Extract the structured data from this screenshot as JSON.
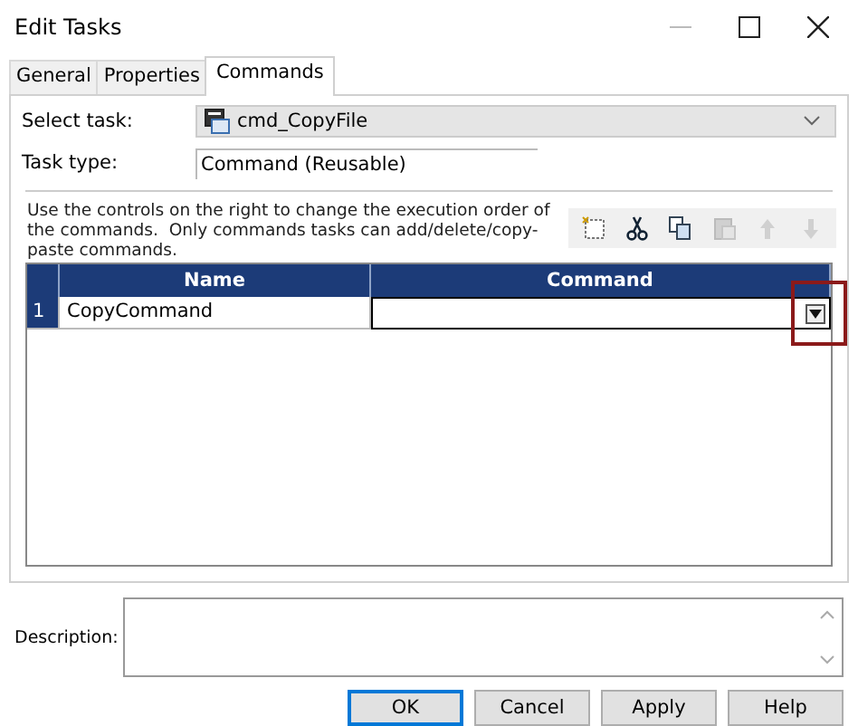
{
  "window": {
    "title": "Edit Tasks"
  },
  "tabs": [
    {
      "label": "General",
      "selected": false
    },
    {
      "label": "Properties",
      "selected": false
    },
    {
      "label": "Commands",
      "selected": true
    }
  ],
  "select_task": {
    "label": "Select task:",
    "value": "cmd_CopyFile"
  },
  "task_type": {
    "label": "Task type:",
    "value": "Command (Reusable)"
  },
  "instructions": "Use the controls on the right to change the execution order of the commands.  Only commands tasks can add/delete/copy-paste commands.",
  "toolbar": [
    {
      "kind": "new",
      "disabled": false
    },
    {
      "kind": "cut",
      "disabled": false
    },
    {
      "kind": "copy",
      "disabled": false
    },
    {
      "kind": "paste",
      "disabled": true
    },
    {
      "kind": "up",
      "disabled": true
    },
    {
      "kind": "down",
      "disabled": true
    }
  ],
  "grid": {
    "columns": [
      "Name",
      "Command"
    ],
    "rows": [
      {
        "number": "1",
        "name": "CopyCommand",
        "command": "",
        "selected": true
      }
    ]
  },
  "description": {
    "label": "Description:"
  },
  "buttons": [
    {
      "label": "OK",
      "default": true
    },
    {
      "label": "Cancel",
      "default": false
    },
    {
      "label": "Apply",
      "default": false
    },
    {
      "label": "Help",
      "default": false
    }
  ]
}
